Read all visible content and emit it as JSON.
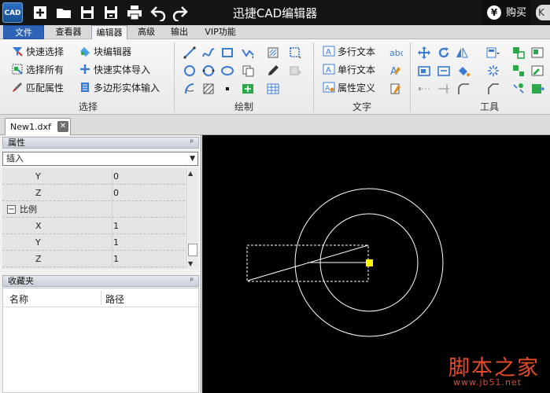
{
  "window": {
    "logo_text": "CAD",
    "title": "迅捷CAD编辑器",
    "buy_label": "购买",
    "buy_icon": "yen-icon",
    "user_initial": "K"
  },
  "menu": {
    "tabs": [
      {
        "label": "文件"
      },
      {
        "label": "查看器"
      },
      {
        "label": "编辑器"
      },
      {
        "label": "高级"
      },
      {
        "label": "输出"
      },
      {
        "label": "VIP功能"
      }
    ],
    "active_tab": "编辑器"
  },
  "ribbon": {
    "groups": {
      "select": {
        "label": "选择",
        "items": [
          "快速选择",
          "块编辑器",
          "选择所有",
          "快速实体导入",
          "匹配属性",
          "多边形实体输入"
        ]
      },
      "draw": {
        "label": "绘制"
      },
      "text": {
        "label": "文字",
        "items": [
          "多行文本",
          "单行文本",
          "属性定义"
        ]
      },
      "tools": {
        "label": "工具"
      }
    }
  },
  "document": {
    "tab_name": "New1.dxf"
  },
  "properties": {
    "title": "属性",
    "pin": "ᵖ",
    "object_type": "插入",
    "rows": [
      {
        "key": "Y",
        "value": "0"
      },
      {
        "key": "Z",
        "value": "0"
      },
      {
        "key": "比例",
        "value": "",
        "section": true,
        "expander": "−"
      },
      {
        "key": "X",
        "value": "1"
      },
      {
        "key": "Y",
        "value": "1"
      },
      {
        "key": "Z",
        "value": "1"
      }
    ]
  },
  "favorites": {
    "title": "收藏夹",
    "columns": [
      "名称",
      "路径"
    ]
  },
  "watermark": {
    "main": "脚本之家",
    "sub": "www.jb51.net"
  },
  "colors": {
    "titlebar": "#151515",
    "file_tab": "#2d64b8",
    "canvas": "#000000",
    "selection_grip": "#ffff00",
    "watermark": "#e54b2b"
  }
}
